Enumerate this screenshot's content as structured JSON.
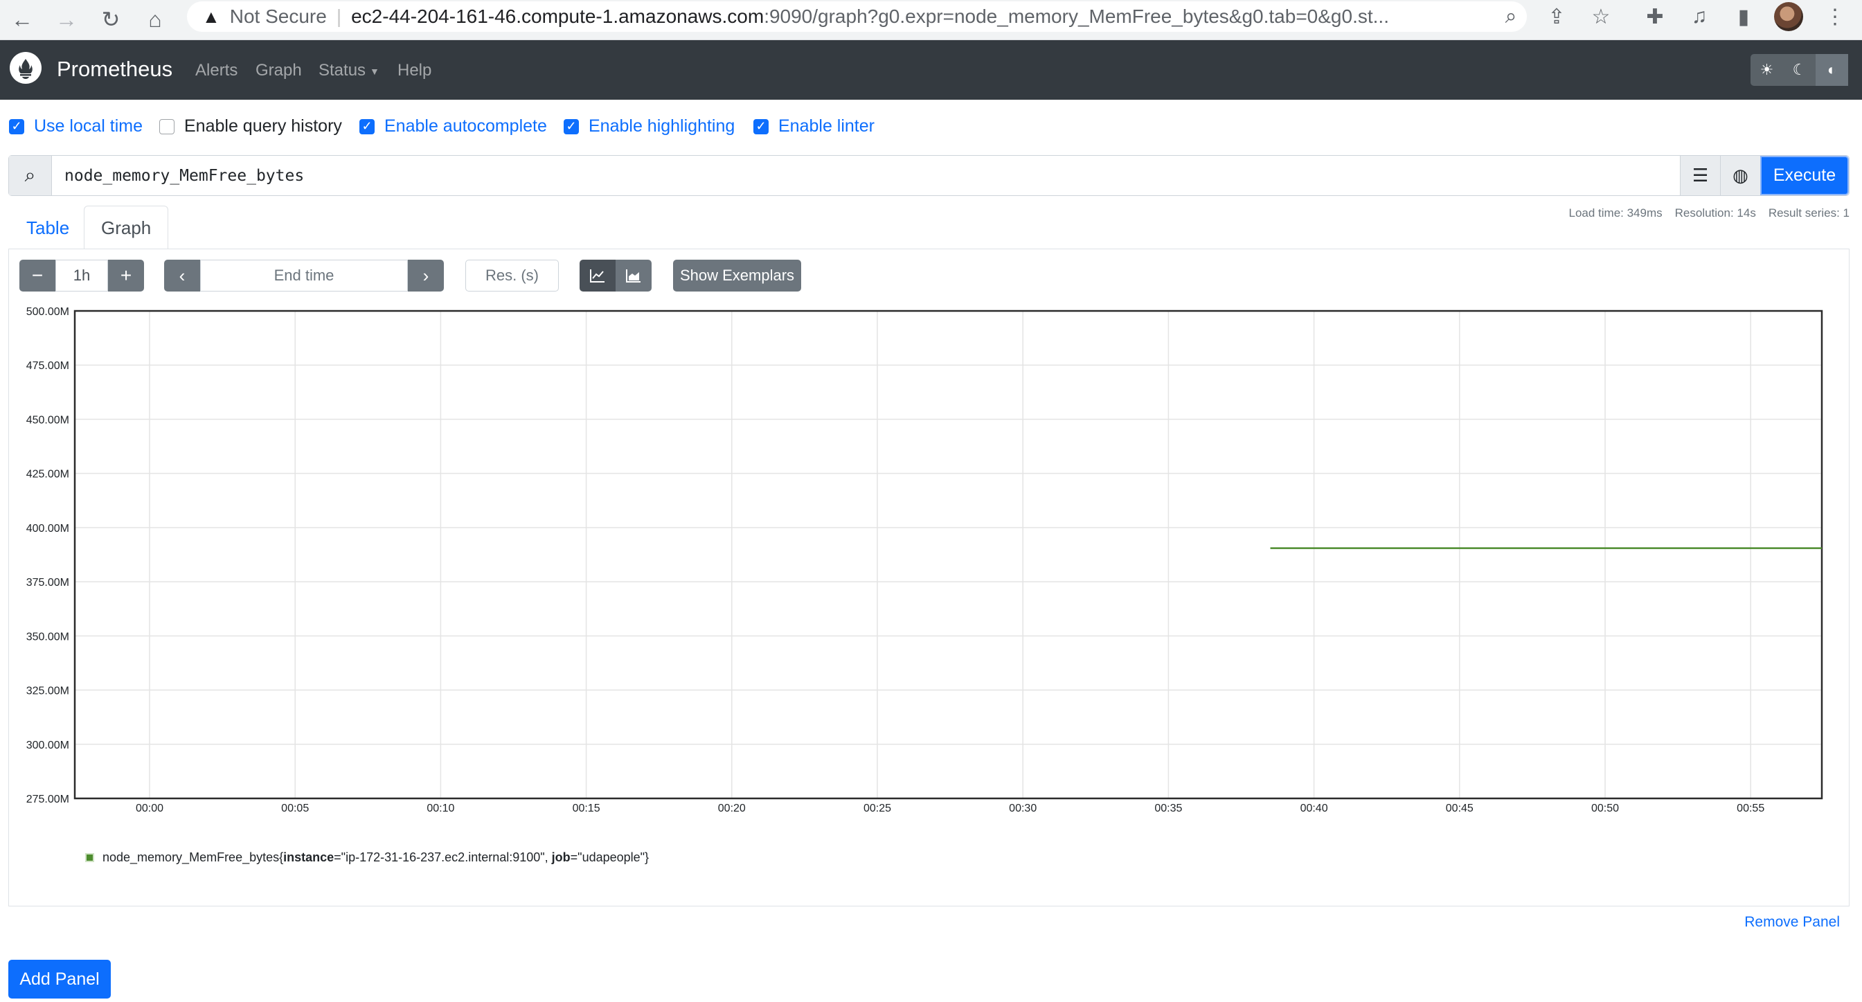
{
  "browser": {
    "security_label": "Not Secure",
    "url_host": "ec2-44-204-161-46.compute-1.amazonaws.com",
    "url_rest": ":9090/graph?g0.expr=node_memory_MemFree_bytes&g0.tab=0&g0.st..."
  },
  "navbar": {
    "brand": "Prometheus",
    "links": [
      "Alerts",
      "Graph",
      "Status",
      "Help"
    ]
  },
  "options": [
    {
      "label": "Use local time",
      "checked": true
    },
    {
      "label": "Enable query history",
      "checked": false
    },
    {
      "label": "Enable autocomplete",
      "checked": true
    },
    {
      "label": "Enable highlighting",
      "checked": true
    },
    {
      "label": "Enable linter",
      "checked": true
    }
  ],
  "query": {
    "expression": "node_memory_MemFree_bytes",
    "execute_label": "Execute"
  },
  "tabs": {
    "table": "Table",
    "graph": "Graph"
  },
  "stats": {
    "load_time": "Load time: 349ms",
    "resolution": "Resolution: 14s",
    "result_series": "Result series: 1"
  },
  "controls": {
    "minus": "−",
    "range": "1h",
    "plus": "+",
    "end_time_placeholder": "End time",
    "res_placeholder": "Res. (s)",
    "show_exemplars": "Show Exemplars"
  },
  "chart_data": {
    "type": "line",
    "y_ticks": [
      "500.00M",
      "475.00M",
      "450.00M",
      "425.00M",
      "400.00M",
      "375.00M",
      "350.00M",
      "325.00M",
      "300.00M",
      "275.00M"
    ],
    "x_ticks": [
      "00:00",
      "00:05",
      "00:10",
      "00:15",
      "00:20",
      "00:25",
      "00:30",
      "00:35",
      "00:40",
      "00:45",
      "00:50",
      "00:55"
    ],
    "ylim": [
      275000000,
      500000000
    ],
    "series": [
      {
        "name": "node_memory_MemFree_bytes",
        "color": "#4d8c2e",
        "x": [
          "00:38:30",
          "00:58:30"
        ],
        "y": [
          390500000,
          390500000
        ]
      }
    ],
    "grid": true
  },
  "legend": {
    "metric": "node_memory_MemFree_bytes",
    "open": "{",
    "instance_key": "instance",
    "instance_val": "=\"ip-172-31-16-237.ec2.internal:9100\", ",
    "job_key": "job",
    "job_val": "=\"udapeople\"}"
  },
  "footer": {
    "remove_panel": "Remove Panel",
    "add_panel": "Add Panel"
  }
}
